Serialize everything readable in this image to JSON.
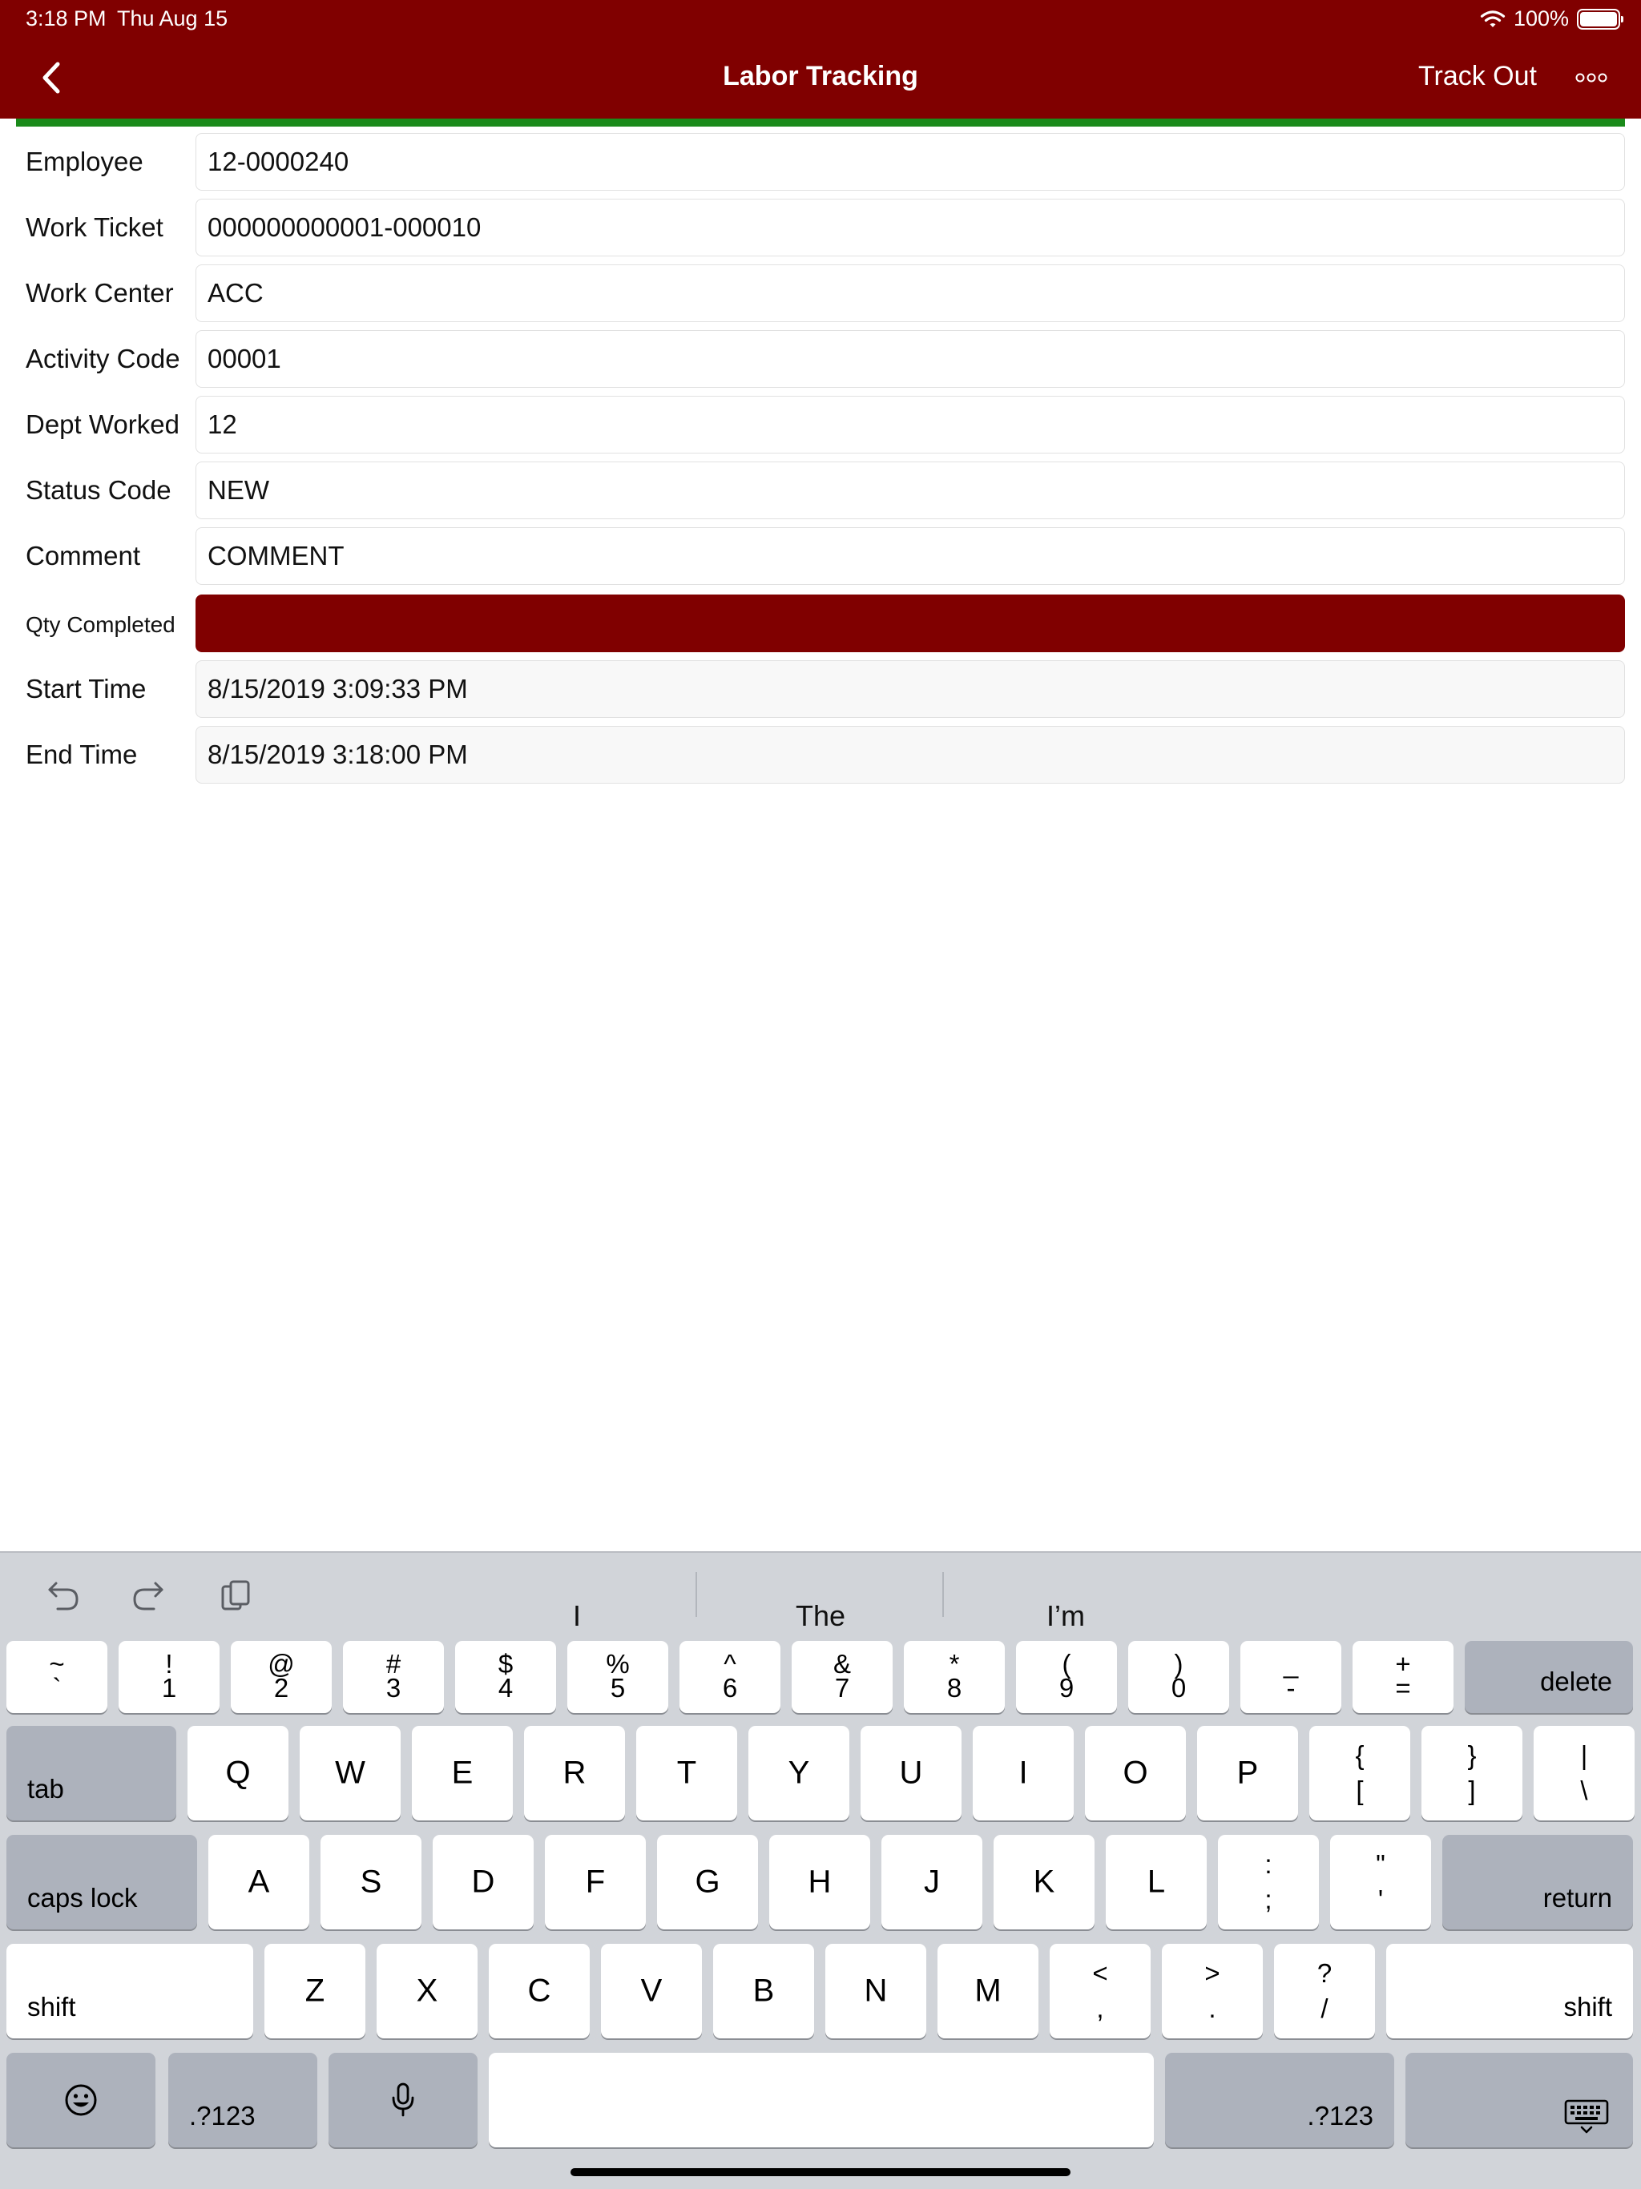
{
  "status_bar": {
    "time": "3:18 PM",
    "date": "Thu Aug 15",
    "battery": "100%"
  },
  "nav": {
    "title": "Labor Tracking",
    "track_out": "Track Out"
  },
  "form": {
    "rows": [
      {
        "label": "Employee",
        "value": "12-0000240"
      },
      {
        "label": "Work Ticket",
        "value": "000000000001-000010"
      },
      {
        "label": "Work Center",
        "value": "ACC"
      },
      {
        "label": "Activity Code",
        "value": "00001"
      },
      {
        "label": "Dept Worked",
        "value": "12"
      },
      {
        "label": "Status Code",
        "value": "NEW"
      },
      {
        "label": "Comment",
        "value": "COMMENT"
      },
      {
        "label": "Qty Completed",
        "value": ""
      },
      {
        "label": "Start Time",
        "value": "8/15/2019 3:09:33 PM"
      },
      {
        "label": "End Time",
        "value": "8/15/2019 3:18:00 PM"
      }
    ]
  },
  "keyboard": {
    "suggestions": [
      "I",
      "The",
      "I’m"
    ],
    "number_row": [
      {
        "top": "~",
        "bot": "`"
      },
      {
        "top": "!",
        "bot": "1"
      },
      {
        "top": "@",
        "bot": "2"
      },
      {
        "top": "#",
        "bot": "3"
      },
      {
        "top": "$",
        "bot": "4"
      },
      {
        "top": "%",
        "bot": "5"
      },
      {
        "top": "^",
        "bot": "6"
      },
      {
        "top": "&",
        "bot": "7"
      },
      {
        "top": "*",
        "bot": "8"
      },
      {
        "top": "(",
        "bot": "9"
      },
      {
        "top": ")",
        "bot": "0"
      },
      {
        "top": "_",
        "bot": "-"
      },
      {
        "top": "+",
        "bot": "="
      }
    ],
    "delete": "delete",
    "tab": "tab",
    "row_q": [
      "Q",
      "W",
      "E",
      "R",
      "T",
      "Y",
      "U",
      "I",
      "O",
      "P"
    ],
    "row_q_sym": [
      {
        "top": "{",
        "bot": "["
      },
      {
        "top": "}",
        "bot": "]"
      },
      {
        "top": "|",
        "bot": "\\"
      }
    ],
    "caps_lock": "caps lock",
    "row_a": [
      "A",
      "S",
      "D",
      "F",
      "G",
      "H",
      "J",
      "K",
      "L"
    ],
    "row_a_sym": [
      {
        "top": ":",
        "bot": ";"
      },
      {
        "top": "\"",
        "bot": "'"
      }
    ],
    "return": "return",
    "shift": "shift",
    "row_z": [
      "Z",
      "X",
      "C",
      "V",
      "B",
      "N",
      "M"
    ],
    "row_z_sym": [
      {
        "top": "<",
        "bot": ","
      },
      {
        "top": ">",
        "bot": "."
      },
      {
        "top": "?",
        "bot": "/"
      }
    ],
    "num_toggle": ".?123",
    "icons": {
      "undo": "undo-icon",
      "redo": "redo-icon",
      "paste": "clipboard-icon",
      "emoji": "emoji-icon",
      "mic": "microphone-icon",
      "dismiss": "keyboard-dismiss-icon"
    }
  },
  "colors": {
    "accent": "#800000",
    "progress": "#1a8a1a",
    "keyboard_bg": "#d1d4d9"
  }
}
